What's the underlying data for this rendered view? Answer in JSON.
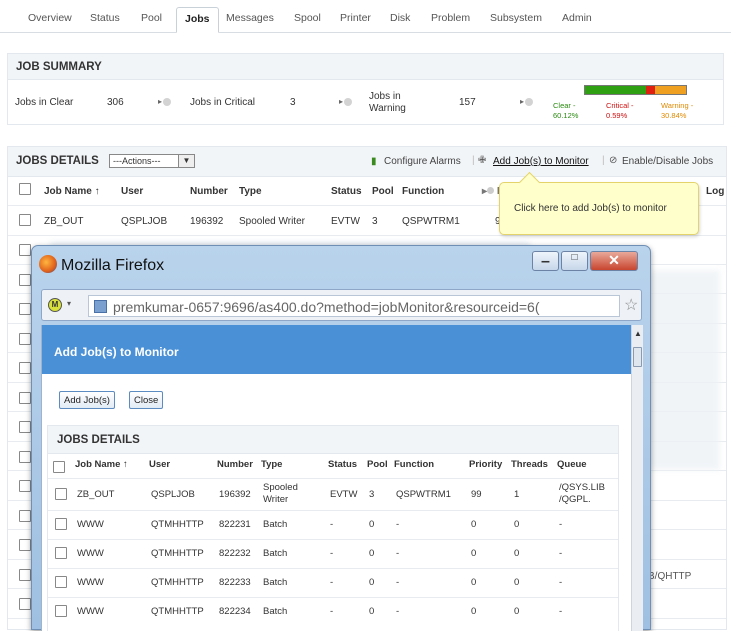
{
  "tabs": [
    "Overview",
    "Status",
    "Pool",
    "Jobs",
    "Messages",
    "Spool",
    "Printer",
    "Disk",
    "Problem",
    "Subsystem",
    "Admin"
  ],
  "active_tab": "Jobs",
  "job_summary": {
    "title": "JOB SUMMARY",
    "clear_label": "Jobs in Clear",
    "clear_value": "306",
    "critical_label": "Jobs in Critical",
    "critical_value": "3",
    "warning_label": "Jobs in Warning",
    "warning_value": "157",
    "legend": {
      "clear": "Clear -",
      "clear_pct": "60.12%",
      "critical": "Critical -",
      "critical_pct": "0.59%",
      "warning": "Warning -",
      "warning_pct": "30.84%"
    },
    "bar": {
      "clear_frac": 0.6012,
      "critical_frac": 0.0059,
      "warning_frac": 0.3084
    },
    "colors": {
      "clear": "#2ea012",
      "critical": "#e02010",
      "warning": "#f0a020"
    }
  },
  "jobs_details": {
    "title": "JOBS DETAILS",
    "actions": "---Actions---",
    "configure_alarms": "Configure Alarms",
    "add_jobs": "Add Job(s) to Monitor",
    "enable_disable": "Enable/Disable Jobs",
    "columns": [
      "Job Name",
      "User",
      "Number",
      "Type",
      "Status",
      "Pool",
      "Function",
      "P"
    ],
    "sort_indicator": "↑",
    "row": [
      "ZB_OUT",
      "QSPLJOB",
      "196392",
      "Spooled Writer",
      "EVTW",
      "3",
      "QSPWTRM1",
      "9"
    ],
    "right_col_header": "Log",
    "right_fragment": "B/QHTTP"
  },
  "tooltip": "Click here to add Job(s) to monitor",
  "popup": {
    "window_title": "Mozilla Firefox",
    "url": "premkumar-0657:9696/as400.do?method=jobMonitor&resourceid=6(",
    "header": "Add Job(s) to Monitor",
    "add_button": "Add Job(s)",
    "close_button": "Close",
    "details_title": "JOBS DETAILS",
    "columns": [
      "Job Name",
      "User",
      "Number",
      "Type",
      "Status",
      "Pool",
      "Function",
      "Priority",
      "Threads",
      "Queue"
    ],
    "sort_indicator": "↑",
    "rows": [
      [
        "ZB_OUT",
        "QSPLJOB",
        "196392",
        "Spooled Writer",
        "EVTW",
        "3",
        "QSPWTRM1",
        "99",
        "1",
        "/QSYS.LIB /QGPL."
      ],
      [
        "WWW",
        "QTMHHTTP",
        "822231",
        "Batch",
        "-",
        "0",
        "-",
        "0",
        "0",
        "-"
      ],
      [
        "WWW",
        "QTMHHTTP",
        "822232",
        "Batch",
        "-",
        "0",
        "-",
        "0",
        "0",
        "-"
      ],
      [
        "WWW",
        "QTMHHTTP",
        "822233",
        "Batch",
        "-",
        "0",
        "-",
        "0",
        "0",
        "-"
      ],
      [
        "WWW",
        "QTMHHTTP",
        "822234",
        "Batch",
        "-",
        "0",
        "-",
        "0",
        "0",
        "-"
      ]
    ]
  }
}
